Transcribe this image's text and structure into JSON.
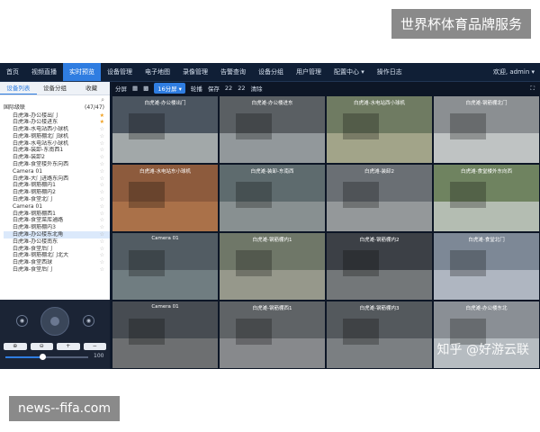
{
  "watermarks": {
    "top": "世界杯体育品牌服务",
    "bottom": "news--fifa.com"
  },
  "nav": {
    "items": [
      "首页",
      "视频直播",
      "实时预览",
      "设备管理",
      "电子地图",
      "录像管理",
      "告警查询",
      "设备分组",
      "用户管理",
      "配置中心 ▾",
      "操作日志"
    ],
    "active_index": 2,
    "user": "欢迎, admin ▾"
  },
  "sidebar": {
    "tabs": [
      "设备列表",
      "设备分组",
      "收藏"
    ],
    "root_label": "国际级联",
    "root_count": "(47/47)",
    "items": [
      "白虎滩-办公楼出门",
      "白虎滩-办公楼进东",
      "白虎滩-水电站西小球机",
      "白虎滩-钢筋棚北门球机",
      "白虎滩-水电站东小球机",
      "白虎滩-装卸-东南西1",
      "白虎滩-装卸2",
      "白虎滩-食堂楼外东向西",
      "Camera 01",
      "白虎滩-大门进路东向西",
      "白虎滩-钢筋棚内1",
      "白虎滩-钢筋棚内2",
      "白虎滩-食堂北门",
      "Camera 01",
      "白虎滩-钢筋棚西1",
      "白虎滩-食堂菜库通路",
      "白虎滩-钢筋棚内3",
      "白虎滩-办公楼东北角",
      "白虎滩-办公楼南东",
      "白虎滩-食堂后门",
      "白虎滩-钢筋棚北门北大",
      "白虎滩-食堂西球",
      "白虎滩-食堂后门"
    ],
    "starred": [
      0,
      1
    ]
  },
  "ptz": {
    "buttons": [
      "⊕",
      "⊖",
      "+",
      "−"
    ],
    "speed": "100",
    "speed_fraction": 0.45
  },
  "toolbar": {
    "split": "分屏",
    "split_option": "16分屏 ▾",
    "rotate": "轮播",
    "save": "保存",
    "n1": "22",
    "n2": "22",
    "clear": "清除"
  },
  "cells": [
    {
      "label": "白虎滩-办公楼出门",
      "bg": "#4b5560",
      "fg": "#c8ccc9"
    },
    {
      "label": "白虎滩-办公楼进东",
      "bg": "#5a5f63",
      "fg": "#a9b0b4"
    },
    {
      "label": "白虎滩-水电站西小球机",
      "bg": "#6f7b62",
      "fg": "#b8b79a"
    },
    {
      "label": "白虎滩-钢筋棚北门",
      "bg": "#8b8f92",
      "fg": "#d6d8d9"
    },
    {
      "label": "白虎滩-水电站东小球机",
      "bg": "#8d5b3d",
      "fg": "#b77a4f"
    },
    {
      "label": "白虎滩-装卸-东南西",
      "bg": "#5e6b6e",
      "fg": "#9aa0a0"
    },
    {
      "label": "白虎滩-装卸2",
      "bg": "#6a6f74",
      "fg": "#a6a9ab"
    },
    {
      "label": "白虎滩-食堂楼外东向西",
      "bg": "#6f8360",
      "fg": "#d2d6d5"
    },
    {
      "label": "Camera 01",
      "bg": "#525c63",
      "fg": "#7d8c8f"
    },
    {
      "label": "白虎滩-钢筋棚内1",
      "bg": "#6f7768",
      "fg": "#a6a69a"
    },
    {
      "label": "白虎滩-钢筋棚内2",
      "bg": "#3c4046",
      "fg": "#8a8e8f"
    },
    {
      "label": "白虎滩-食堂北门",
      "bg": "#7d8896",
      "fg": "#c4cad3"
    },
    {
      "label": "Camera 01",
      "bg": "#474c52",
      "fg": "#7d7f7f"
    },
    {
      "label": "白虎滩-钢筋棚西1",
      "bg": "#5f6366",
      "fg": "#989a9c"
    },
    {
      "label": "白虎滩-钢筋棚内3",
      "bg": "#54595d",
      "fg": "#8c9093"
    },
    {
      "label": "白虎滩-办公楼东北",
      "bg": "#8a8f95",
      "fg": "#c9ced4"
    }
  ],
  "overlay_text": "知乎 @好游云联"
}
